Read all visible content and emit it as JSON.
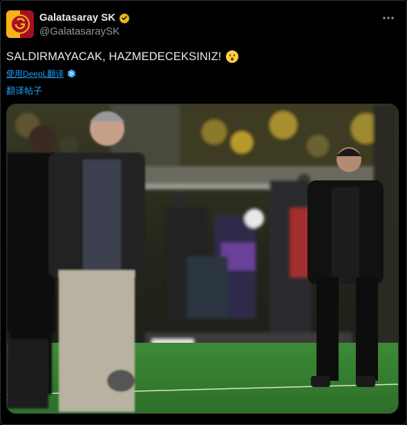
{
  "account": {
    "display_name": "Galatasaray SK",
    "handle": "@GalatasaraySK"
  },
  "tweet": {
    "text": "SALDIRMAYACAK, HAZMEDECEKSINIZ!",
    "emoji": "hushed-face"
  },
  "deepl": {
    "label": "使用DeepL翻译"
  },
  "translate_post": {
    "label": "翻译帖子"
  },
  "media": {
    "kind": "photo",
    "subject": "two-coaches-on-touchline-stadium-night"
  },
  "colors": {
    "background": "#000000",
    "link": "#1d9bf0",
    "text": "#e7e9ea",
    "muted": "#8b98a5",
    "verified_gold": "#e8b71a",
    "pitch": "#2f7a2e"
  }
}
